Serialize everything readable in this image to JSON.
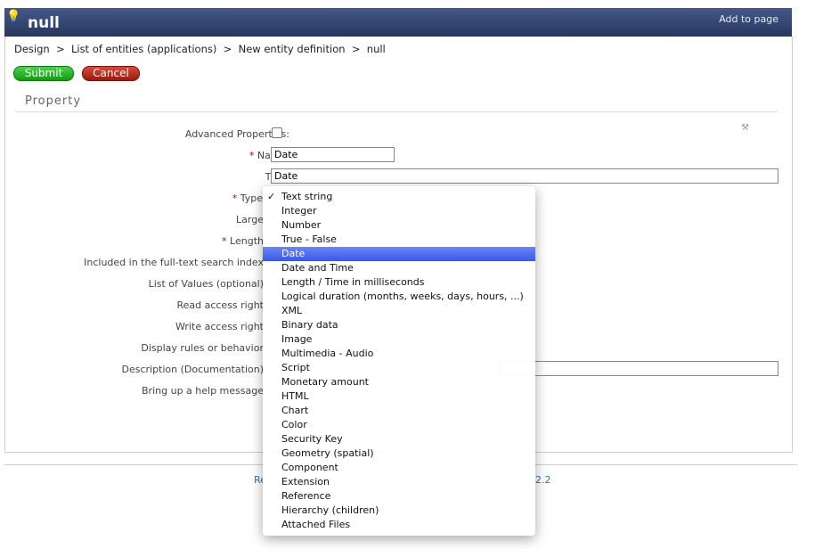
{
  "header": {
    "title": "null",
    "add_to_page": "Add to page",
    "icon": "lightbulb-icon"
  },
  "breadcrumb": "Design  >  List of entities (applications)  >  New entity definition  >  null",
  "buttons": {
    "submit": "Submit",
    "cancel": "Cancel"
  },
  "section": "Property",
  "form": {
    "advanced": "Advanced Properties:",
    "name_label": "Name:",
    "name_value": "Date",
    "title_label": "Title:",
    "title_value": "Date",
    "type_label": "Type",
    "large_label": "Large",
    "length_label": "Length",
    "fulltext_label": "Included in the full-text search index",
    "lov_label": "List of Values (optional)",
    "read_label": "Read access right",
    "write_label": "Write access right",
    "display_label": "Display rules or behavior",
    "desc_label": "Description (Documentation)",
    "help_label": "Bring up a help message"
  },
  "footer": {
    "left": "Re",
    "right": "2.2"
  },
  "dropdown": {
    "checked": "Text string",
    "highlighted": "Date",
    "items": [
      "Text string",
      "Integer",
      "Number",
      "True - False",
      "Date",
      "Date and Time",
      "Length / Time in milliseconds",
      "Logical duration (months, weeks, days, hours, ...)",
      "XML",
      "Binary data",
      "Image",
      "Multimedia - Audio",
      "Script",
      "Monetary amount",
      "HTML",
      "Chart",
      "Color",
      "Security Key",
      "Geometry (spatial)",
      "Component",
      "Extension",
      "Reference",
      "Hierarchy (children)",
      "Attached Files"
    ]
  }
}
